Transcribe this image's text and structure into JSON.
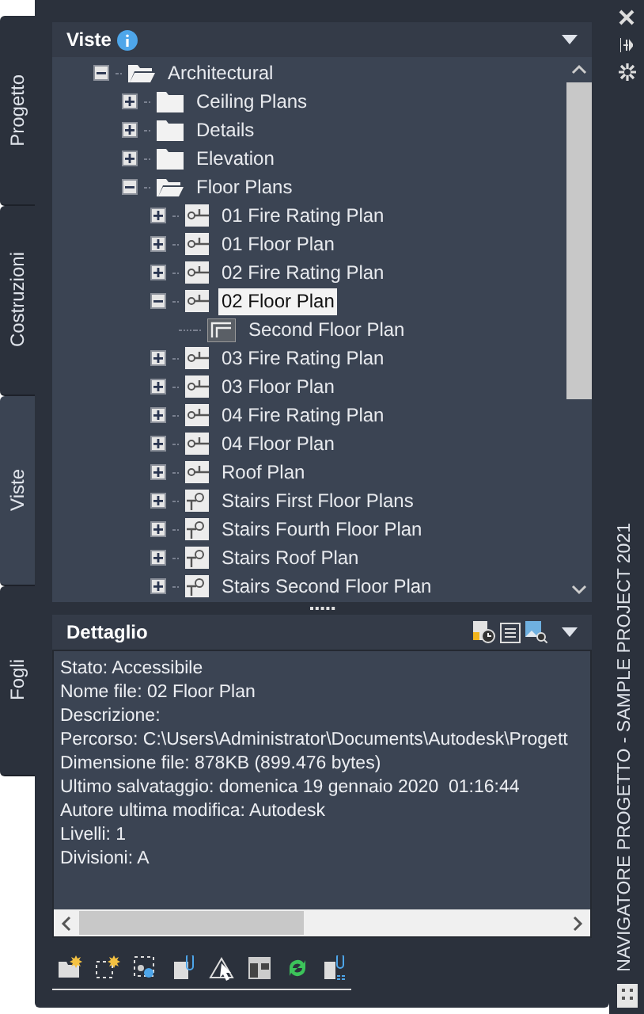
{
  "side_tabs": [
    {
      "label": "Progetto",
      "selected": false
    },
    {
      "label": "Costruzioni",
      "selected": false
    },
    {
      "label": "Viste",
      "selected": true
    },
    {
      "label": "Fogli",
      "selected": false
    }
  ],
  "panel_title": "NAVIGATORE PROGETTO - SAMPLE PROJECT 2021",
  "views": {
    "title": "Viste",
    "tree": [
      {
        "label": "Architectural",
        "kind": "folder",
        "expanded": true,
        "selected": false,
        "children": [
          {
            "label": "Ceiling Plans",
            "kind": "folder",
            "expanded": false,
            "selected": false
          },
          {
            "label": "Details",
            "kind": "folder",
            "expanded": false,
            "selected": false
          },
          {
            "label": "Elevation",
            "kind": "folder",
            "expanded": false,
            "selected": false
          },
          {
            "label": "Floor Plans",
            "kind": "folder",
            "expanded": true,
            "selected": false,
            "children": [
              {
                "label": "01 Fire Rating Plan",
                "kind": "plan",
                "expanded": false,
                "selected": false
              },
              {
                "label": "01 Floor Plan",
                "kind": "plan",
                "expanded": false,
                "selected": false
              },
              {
                "label": "02 Fire Rating Plan",
                "kind": "plan",
                "expanded": false,
                "selected": false
              },
              {
                "label": "02 Floor Plan",
                "kind": "plan",
                "expanded": true,
                "selected": true,
                "children": [
                  {
                    "label": "Second Floor Plan",
                    "kind": "sheet",
                    "selected": false
                  }
                ]
              },
              {
                "label": "03 Fire Rating Plan",
                "kind": "plan",
                "expanded": false,
                "selected": false
              },
              {
                "label": "03 Floor Plan",
                "kind": "plan",
                "expanded": false,
                "selected": false
              },
              {
                "label": "04 Fire Rating Plan",
                "kind": "plan",
                "expanded": false,
                "selected": false
              },
              {
                "label": "04 Floor Plan",
                "kind": "plan",
                "expanded": false,
                "selected": false
              },
              {
                "label": "Roof Plan",
                "kind": "plan",
                "expanded": false,
                "selected": false
              },
              {
                "label": "Stairs First Floor Plans",
                "kind": "stairs",
                "expanded": false,
                "selected": false
              },
              {
                "label": "Stairs Fourth Floor Plan",
                "kind": "stairs",
                "expanded": false,
                "selected": false
              },
              {
                "label": "Stairs Roof Plan",
                "kind": "stairs",
                "expanded": false,
                "selected": false
              },
              {
                "label": "Stairs Second Floor Plan",
                "kind": "stairs",
                "expanded": false,
                "selected": false
              }
            ]
          }
        ]
      }
    ]
  },
  "detail": {
    "title": "Dettaglio",
    "lines": [
      "Stato: Accessibile",
      "Nome file: 02 Floor Plan",
      "Descrizione:",
      "Percorso: C:\\Users\\Administrator\\Documents\\Autodesk\\Progett",
      "Dimensione file: 878KB (899.476 bytes)",
      "Ultimo salvataggio: domenica 19 gennaio 2020  01:16:44",
      "Autore ultima modifica: Autodesk",
      "Livelli: 1",
      "Divisioni: A"
    ]
  }
}
